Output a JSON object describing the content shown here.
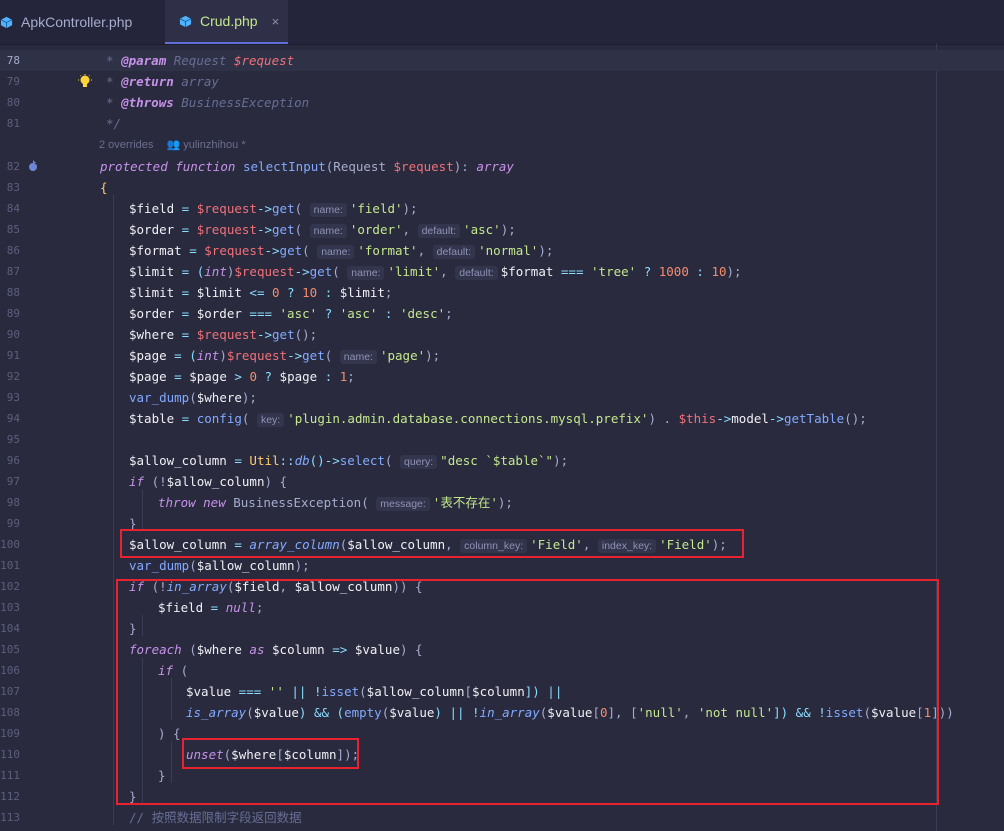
{
  "tabs": [
    {
      "label": "ApkController.php",
      "active": false
    },
    {
      "label": "Crud.php",
      "active": true,
      "close": "×"
    }
  ],
  "inlay": {
    "overrides": "2 overrides",
    "author": "yulinzhihou *"
  },
  "lines": [
    "78",
    "79",
    "80",
    "81",
    "82",
    "83",
    "84",
    "85",
    "86",
    "87",
    "88",
    "89",
    "90",
    "91",
    "92",
    "93",
    "94",
    "95",
    "96",
    "97",
    "98",
    "99",
    "100",
    "101",
    "102",
    "103",
    "104",
    "105",
    "106",
    "107",
    "108",
    "109",
    "110",
    "111",
    "112",
    "113"
  ],
  "code": {
    "l78": [
      "* ",
      "@param",
      " Request ",
      "$request"
    ],
    "l79": [
      "* ",
      "@return",
      " array"
    ],
    "l80": [
      "* ",
      "@throws",
      " BusinessException"
    ],
    "l81": "*/",
    "l82": [
      "protected function",
      " selectInput",
      "(Request ",
      "$request",
      "): ",
      "array"
    ],
    "l83": "{",
    "l84": [
      "$field",
      " = ",
      "$request",
      "->",
      "get",
      "( ",
      "name:",
      "'field'",
      ");"
    ],
    "l85": [
      "$order",
      " = ",
      "$request",
      "->",
      "get",
      "( ",
      "name:",
      "'order'",
      ", ",
      "default:",
      "'asc'",
      ");"
    ],
    "l86": [
      "$format",
      " = ",
      "$request",
      "->",
      "get",
      "( ",
      "name:",
      "'format'",
      ", ",
      "default:",
      "'normal'",
      ");"
    ],
    "l87": [
      "$limit",
      " = (",
      "int",
      ")",
      "$request",
      "->",
      "get",
      "( ",
      "name:",
      "'limit'",
      ", ",
      "default:",
      "$format",
      " === ",
      "'tree'",
      " ? ",
      "1000",
      " : ",
      "10",
      ");"
    ],
    "l88": [
      "$limit",
      " = ",
      "$limit",
      " <= ",
      "0",
      " ? ",
      "10",
      " : ",
      "$limit",
      ";"
    ],
    "l89": [
      "$order",
      " = ",
      "$order",
      " === ",
      "'asc'",
      " ? ",
      "'asc'",
      " : ",
      "'desc'",
      ";"
    ],
    "l90": [
      "$where",
      " = ",
      "$request",
      "->",
      "get",
      "();"
    ],
    "l91": [
      "$page",
      " = (",
      "int",
      ")",
      "$request",
      "->",
      "get",
      "( ",
      "name:",
      "'page'",
      ");"
    ],
    "l92": [
      "$page",
      " = ",
      "$page",
      " > ",
      "0",
      " ? ",
      "$page",
      " : ",
      "1",
      ";"
    ],
    "l93": [
      "var_dump",
      "(",
      "$where",
      ");"
    ],
    "l94": [
      "$table",
      " = ",
      "config",
      "( ",
      "key:",
      "'plugin.admin.database.connections.mysql.prefix'",
      ") . ",
      "$this",
      "->",
      "model",
      "->",
      "getTable",
      "();"
    ],
    "l96": [
      "$allow_column",
      " = ",
      "Util",
      "::",
      "db",
      "()->",
      "select",
      "( ",
      "query:",
      "\"desc `$table`\"",
      ");"
    ],
    "l97": [
      "if",
      " (!",
      "$allow_column",
      ") {"
    ],
    "l98": [
      "throw new",
      " BusinessException",
      "( ",
      "message:",
      "'表不存在'",
      ");"
    ],
    "l99": "}",
    "l100": [
      "$allow_column",
      " = ",
      "array_column",
      "(",
      "$allow_column",
      ", ",
      "column_key:",
      "'Field'",
      ", ",
      "index_key:",
      "'Field'",
      ");"
    ],
    "l101": [
      "var_dump",
      "(",
      "$allow_column",
      ");"
    ],
    "l102": [
      "if",
      " (!",
      "in_array",
      "(",
      "$field",
      ", ",
      "$allow_column",
      ")) {"
    ],
    "l103": [
      "$field",
      " = ",
      "null",
      ";"
    ],
    "l104": "}",
    "l105": [
      "foreach",
      " (",
      "$where",
      " as ",
      "$column",
      " => ",
      "$value",
      ") {"
    ],
    "l106": [
      "if",
      " ("
    ],
    "l107": [
      "$value",
      " === ",
      "''",
      " || !",
      "isset",
      "(",
      "$allow_column",
      "[",
      "$column",
      "]) ||"
    ],
    "l108": [
      "is_array",
      "(",
      "$value",
      ") && (",
      "empty",
      "(",
      "$value",
      ") || !",
      "in_array",
      "(",
      "$value",
      "[",
      "0",
      "], [",
      "'null'",
      ", ",
      "'not null'",
      "]) && !",
      "isset",
      "(",
      "$value",
      "[",
      "1",
      "]))"
    ],
    "l109": ") {",
    "l110": [
      "unset",
      "(",
      "$where",
      "[",
      "$column",
      "]);"
    ],
    "l111": "}",
    "l112": "}",
    "l113": "// 按照数据限制字段返回数据"
  }
}
